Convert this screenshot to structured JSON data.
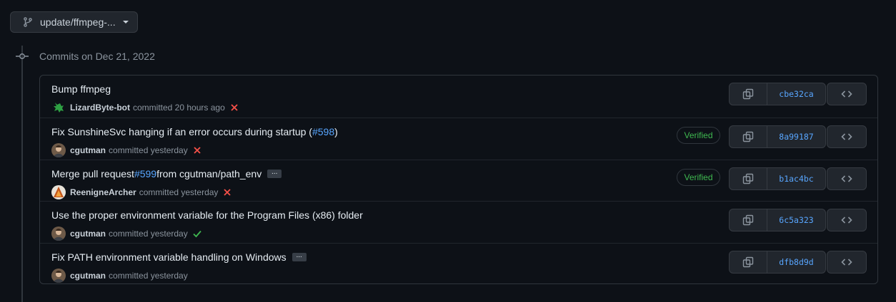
{
  "branch": {
    "label": "update/ffmpeg-...",
    "icon": "git-branch-icon"
  },
  "timeline": {
    "date_heading": "Commits on Dec 21, 2022"
  },
  "commits": [
    {
      "title": "Bump ffmpeg",
      "title_link": "",
      "title_suffix": "",
      "has_ellipsis": false,
      "author": "LizardByte-bot",
      "committed_text": "committed 20 hours ago",
      "status": "failed",
      "verified": false,
      "sha": "cbe32ca"
    },
    {
      "title": "Fix SunshineSvc hanging if an error occurs during startup (",
      "title_link": "#598",
      "title_suffix": ")",
      "has_ellipsis": false,
      "author": "cgutman",
      "committed_text": "committed yesterday",
      "status": "failed",
      "verified": true,
      "verified_label": "Verified",
      "sha": "8a99187"
    },
    {
      "title": "Merge pull request ",
      "title_link": "#599",
      "title_suffix": " from cgutman/path_env",
      "has_ellipsis": true,
      "author": "ReenigneArcher",
      "committed_text": "committed yesterday",
      "status": "failed",
      "verified": true,
      "verified_label": "Verified",
      "sha": "b1ac4bc"
    },
    {
      "title": "Use the proper environment variable for the Program Files (x86) folder",
      "title_link": "",
      "title_suffix": "",
      "has_ellipsis": false,
      "author": "cgutman",
      "committed_text": "committed yesterday",
      "status": "success",
      "verified": false,
      "sha": "6c5a323"
    },
    {
      "title": "Fix PATH environment variable handling on Windows",
      "title_link": "",
      "title_suffix": "",
      "has_ellipsis": true,
      "author": "cgutman",
      "committed_text": "committed yesterday",
      "status": "none",
      "verified": false,
      "sha": "dfb8d9d"
    }
  ],
  "colors": {
    "background": "#0d1117",
    "link": "#58a6ff",
    "failed": "#f85149",
    "success": "#3fb950"
  },
  "icons": {
    "copy": "copy-icon",
    "browse": "code-icon",
    "failed": "x-icon",
    "success": "check-icon",
    "commit_node": "git-commit-icon"
  }
}
